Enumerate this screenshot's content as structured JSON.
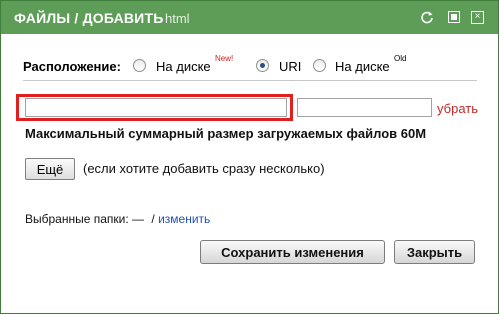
{
  "titlebar": {
    "title": "ФАЙЛЫ / ДОБАВИТЬ",
    "subtitle": "html",
    "icons": [
      "refresh-icon",
      "maximize-icon",
      "close-icon"
    ],
    "color": "#5e9d58"
  },
  "location": {
    "label": "Расположение:",
    "options": [
      {
        "label": "На диске",
        "badge": "New!",
        "badge_color": "#d01f1f",
        "checked": false
      },
      {
        "label": "URI",
        "badge": "",
        "checked": true
      },
      {
        "label": "На диске",
        "badge": "Old",
        "badge_color": "#000000",
        "checked": false
      }
    ]
  },
  "upload": {
    "url_value": "",
    "remove_label": "убрать",
    "max_size_text": "Максимальный суммарный размер загружаемых файлов 60М"
  },
  "more": {
    "button_label": "Ещё",
    "hint": "(если хотите добавить сразу несколько)"
  },
  "folders": {
    "label": "Выбранные папки:",
    "value": "—",
    "separator": "/",
    "change_label": "изменить"
  },
  "actions": {
    "save_label": "Сохранить изменения",
    "close_label": "Закрыть"
  }
}
